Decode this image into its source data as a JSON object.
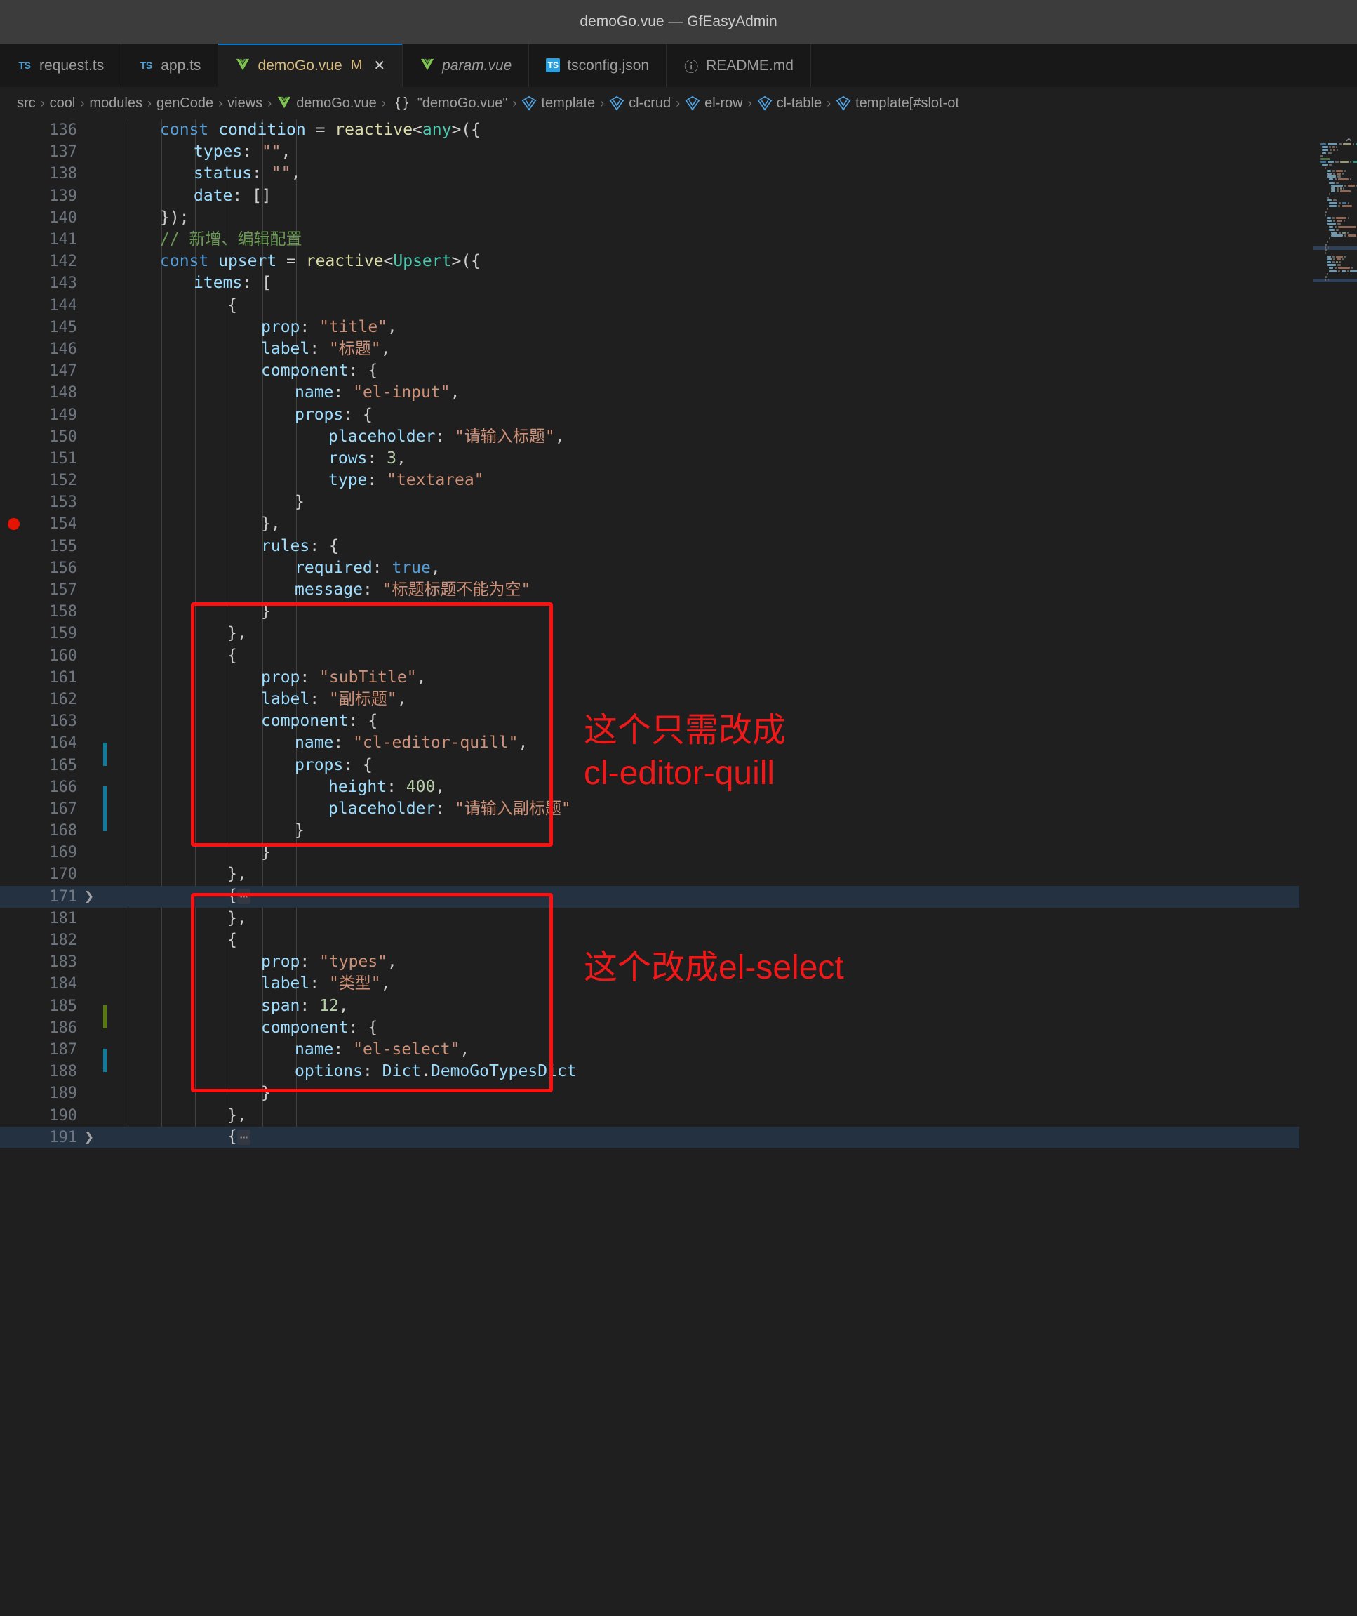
{
  "window": {
    "title": "demoGo.vue — GfEasyAdmin"
  },
  "tabs": [
    {
      "name": "request.ts",
      "icon": "typescript-icon",
      "active": false,
      "preview": false,
      "modified": false,
      "closable": false
    },
    {
      "name": "app.ts",
      "icon": "typescript-icon",
      "active": false,
      "preview": false,
      "modified": false,
      "closable": false
    },
    {
      "name": "demoGo.vue",
      "icon": "vue-icon",
      "active": true,
      "preview": false,
      "modified": true,
      "modified_mark": "M",
      "closable": true,
      "close_glyph": "✕"
    },
    {
      "name": "param.vue",
      "icon": "vue-icon",
      "active": false,
      "preview": true,
      "modified": false,
      "closable": false
    },
    {
      "name": "tsconfig.json",
      "icon": "tsconfig-icon",
      "active": false,
      "preview": false,
      "modified": false,
      "closable": false
    },
    {
      "name": "README.md",
      "icon": "info-icon",
      "active": false,
      "preview": false,
      "modified": false,
      "closable": false
    }
  ],
  "breadcrumb": {
    "separator": "›",
    "items": [
      {
        "label": "src",
        "icon": "none"
      },
      {
        "label": "cool",
        "icon": "none"
      },
      {
        "label": "modules",
        "icon": "none"
      },
      {
        "label": "genCode",
        "icon": "none"
      },
      {
        "label": "views",
        "icon": "none"
      },
      {
        "label": "demoGo.vue",
        "icon": "vue-icon"
      },
      {
        "label": "\"demoGo.vue\"",
        "icon": "braces-icon"
      },
      {
        "label": "template",
        "icon": "symbol-vue-icon"
      },
      {
        "label": "cl-crud",
        "icon": "symbol-vue-icon"
      },
      {
        "label": "el-row",
        "icon": "symbol-vue-icon"
      },
      {
        "label": "cl-table",
        "icon": "symbol-vue-icon"
      },
      {
        "label": "template[#slot-ot",
        "icon": "symbol-vue-icon"
      }
    ]
  },
  "editor": {
    "breakpoint_line": 154,
    "highlighted_lines": [
      171,
      191
    ],
    "diff_modified_lines": [
      164,
      166,
      167,
      187
    ],
    "diff_added_lines": [
      185
    ],
    "folded_lines": [
      171,
      191
    ],
    "fold_placeholder": "⋯",
    "lines": [
      {
        "n": 136,
        "tokens": [
          {
            "t": "kw",
            "v": "const "
          },
          {
            "t": "var",
            "v": "condition"
          },
          {
            "t": "pn",
            "v": " = "
          },
          {
            "t": "fn",
            "v": "reactive"
          },
          {
            "t": "pn",
            "v": "<"
          },
          {
            "t": "type",
            "v": "any"
          },
          {
            "t": "pn",
            "v": ">({"
          }
        ],
        "indent": 1
      },
      {
        "n": 137,
        "tokens": [
          {
            "t": "var",
            "v": "types"
          },
          {
            "t": "pn",
            "v": ": "
          },
          {
            "t": "str",
            "v": "\"\""
          },
          {
            "t": "pn",
            "v": ","
          }
        ],
        "indent": 2
      },
      {
        "n": 138,
        "tokens": [
          {
            "t": "var",
            "v": "status"
          },
          {
            "t": "pn",
            "v": ": "
          },
          {
            "t": "str",
            "v": "\"\""
          },
          {
            "t": "pn",
            "v": ","
          }
        ],
        "indent": 2
      },
      {
        "n": 139,
        "tokens": [
          {
            "t": "var",
            "v": "date"
          },
          {
            "t": "pn",
            "v": ": []"
          }
        ],
        "indent": 2
      },
      {
        "n": 140,
        "tokens": [
          {
            "t": "pn",
            "v": "});"
          }
        ],
        "indent": 1
      },
      {
        "n": 141,
        "tokens": [
          {
            "t": "cmt",
            "v": "// 新增、编辑配置"
          }
        ],
        "indent": 1
      },
      {
        "n": 142,
        "tokens": [
          {
            "t": "kw",
            "v": "const "
          },
          {
            "t": "var",
            "v": "upsert"
          },
          {
            "t": "pn",
            "v": " = "
          },
          {
            "t": "fn",
            "v": "reactive"
          },
          {
            "t": "pn",
            "v": "<"
          },
          {
            "t": "type",
            "v": "Upsert"
          },
          {
            "t": "pn",
            "v": ">({"
          }
        ],
        "indent": 1
      },
      {
        "n": 143,
        "tokens": [
          {
            "t": "var",
            "v": "items"
          },
          {
            "t": "pn",
            "v": ": ["
          }
        ],
        "indent": 2
      },
      {
        "n": 144,
        "tokens": [
          {
            "t": "pn",
            "v": "{"
          }
        ],
        "indent": 3
      },
      {
        "n": 145,
        "tokens": [
          {
            "t": "var",
            "v": "prop"
          },
          {
            "t": "pn",
            "v": ": "
          },
          {
            "t": "str",
            "v": "\"title\""
          },
          {
            "t": "pn",
            "v": ","
          }
        ],
        "indent": 4
      },
      {
        "n": 146,
        "tokens": [
          {
            "t": "var",
            "v": "label"
          },
          {
            "t": "pn",
            "v": ": "
          },
          {
            "t": "str",
            "v": "\"标题\""
          },
          {
            "t": "pn",
            "v": ","
          }
        ],
        "indent": 4
      },
      {
        "n": 147,
        "tokens": [
          {
            "t": "var",
            "v": "component"
          },
          {
            "t": "pn",
            "v": ": {"
          }
        ],
        "indent": 4
      },
      {
        "n": 148,
        "tokens": [
          {
            "t": "var",
            "v": "name"
          },
          {
            "t": "pn",
            "v": ": "
          },
          {
            "t": "str",
            "v": "\"el-input\""
          },
          {
            "t": "pn",
            "v": ","
          }
        ],
        "indent": 5
      },
      {
        "n": 149,
        "tokens": [
          {
            "t": "var",
            "v": "props"
          },
          {
            "t": "pn",
            "v": ": {"
          }
        ],
        "indent": 5
      },
      {
        "n": 150,
        "tokens": [
          {
            "t": "var",
            "v": "placeholder"
          },
          {
            "t": "pn",
            "v": ": "
          },
          {
            "t": "str",
            "v": "\"请输入标题\""
          },
          {
            "t": "pn",
            "v": ","
          }
        ],
        "indent": 6
      },
      {
        "n": 151,
        "tokens": [
          {
            "t": "var",
            "v": "rows"
          },
          {
            "t": "pn",
            "v": ": "
          },
          {
            "t": "num",
            "v": "3"
          },
          {
            "t": "pn",
            "v": ","
          }
        ],
        "indent": 6
      },
      {
        "n": 152,
        "tokens": [
          {
            "t": "var",
            "v": "type"
          },
          {
            "t": "pn",
            "v": ": "
          },
          {
            "t": "str",
            "v": "\"textarea\""
          }
        ],
        "indent": 6
      },
      {
        "n": 153,
        "tokens": [
          {
            "t": "pn",
            "v": "}"
          }
        ],
        "indent": 5
      },
      {
        "n": 154,
        "tokens": [
          {
            "t": "pn",
            "v": "},"
          }
        ],
        "indent": 4
      },
      {
        "n": 155,
        "tokens": [
          {
            "t": "var",
            "v": "rules"
          },
          {
            "t": "pn",
            "v": ": {"
          }
        ],
        "indent": 4
      },
      {
        "n": 156,
        "tokens": [
          {
            "t": "var",
            "v": "required"
          },
          {
            "t": "pn",
            "v": ": "
          },
          {
            "t": "kw",
            "v": "true"
          },
          {
            "t": "pn",
            "v": ","
          }
        ],
        "indent": 5
      },
      {
        "n": 157,
        "tokens": [
          {
            "t": "var",
            "v": "message"
          },
          {
            "t": "pn",
            "v": ": "
          },
          {
            "t": "str",
            "v": "\"标题标题不能为空\""
          }
        ],
        "indent": 5
      },
      {
        "n": 158,
        "tokens": [
          {
            "t": "pn",
            "v": "}"
          }
        ],
        "indent": 4
      },
      {
        "n": 159,
        "tokens": [
          {
            "t": "pn",
            "v": "},"
          }
        ],
        "indent": 3
      },
      {
        "n": 160,
        "tokens": [
          {
            "t": "pn",
            "v": "{"
          }
        ],
        "indent": 3
      },
      {
        "n": 161,
        "tokens": [
          {
            "t": "var",
            "v": "prop"
          },
          {
            "t": "pn",
            "v": ": "
          },
          {
            "t": "str",
            "v": "\"subTitle\""
          },
          {
            "t": "pn",
            "v": ","
          }
        ],
        "indent": 4
      },
      {
        "n": 162,
        "tokens": [
          {
            "t": "var",
            "v": "label"
          },
          {
            "t": "pn",
            "v": ": "
          },
          {
            "t": "str",
            "v": "\"副标题\""
          },
          {
            "t": "pn",
            "v": ","
          }
        ],
        "indent": 4
      },
      {
        "n": 163,
        "tokens": [
          {
            "t": "var",
            "v": "component"
          },
          {
            "t": "pn",
            "v": ": {"
          }
        ],
        "indent": 4
      },
      {
        "n": 164,
        "tokens": [
          {
            "t": "var",
            "v": "name"
          },
          {
            "t": "pn",
            "v": ": "
          },
          {
            "t": "str",
            "v": "\"cl-editor-quill\""
          },
          {
            "t": "pn",
            "v": ","
          }
        ],
        "indent": 5
      },
      {
        "n": 165,
        "tokens": [
          {
            "t": "var",
            "v": "props"
          },
          {
            "t": "pn",
            "v": ": {"
          }
        ],
        "indent": 5
      },
      {
        "n": 166,
        "tokens": [
          {
            "t": "var",
            "v": "height"
          },
          {
            "t": "pn",
            "v": ": "
          },
          {
            "t": "num",
            "v": "400"
          },
          {
            "t": "pn",
            "v": ","
          }
        ],
        "indent": 6
      },
      {
        "n": 167,
        "tokens": [
          {
            "t": "var",
            "v": "placeholder"
          },
          {
            "t": "pn",
            "v": ": "
          },
          {
            "t": "str",
            "v": "\"请输入副标题\""
          }
        ],
        "indent": 6
      },
      {
        "n": 168,
        "tokens": [
          {
            "t": "pn",
            "v": "}"
          }
        ],
        "indent": 5
      },
      {
        "n": 169,
        "tokens": [
          {
            "t": "pn",
            "v": "}"
          }
        ],
        "indent": 4
      },
      {
        "n": 170,
        "tokens": [
          {
            "t": "pn",
            "v": "},"
          }
        ],
        "indent": 3
      },
      {
        "n": 171,
        "tokens": [
          {
            "t": "pn",
            "v": "{"
          },
          {
            "t": "fold",
            "v": "⋯"
          }
        ],
        "indent": 3
      },
      {
        "n": 181,
        "tokens": [
          {
            "t": "pn",
            "v": "},"
          }
        ],
        "indent": 3
      },
      {
        "n": 182,
        "tokens": [
          {
            "t": "pn",
            "v": "{"
          }
        ],
        "indent": 3
      },
      {
        "n": 183,
        "tokens": [
          {
            "t": "var",
            "v": "prop"
          },
          {
            "t": "pn",
            "v": ": "
          },
          {
            "t": "str",
            "v": "\"types\""
          },
          {
            "t": "pn",
            "v": ","
          }
        ],
        "indent": 4
      },
      {
        "n": 184,
        "tokens": [
          {
            "t": "var",
            "v": "label"
          },
          {
            "t": "pn",
            "v": ": "
          },
          {
            "t": "str",
            "v": "\"类型\""
          },
          {
            "t": "pn",
            "v": ","
          }
        ],
        "indent": 4
      },
      {
        "n": 185,
        "tokens": [
          {
            "t": "var",
            "v": "span"
          },
          {
            "t": "pn",
            "v": ": "
          },
          {
            "t": "num",
            "v": "12"
          },
          {
            "t": "pn",
            "v": ","
          }
        ],
        "indent": 4
      },
      {
        "n": 186,
        "tokens": [
          {
            "t": "var",
            "v": "component"
          },
          {
            "t": "pn",
            "v": ": {"
          }
        ],
        "indent": 4
      },
      {
        "n": 187,
        "tokens": [
          {
            "t": "var",
            "v": "name"
          },
          {
            "t": "pn",
            "v": ": "
          },
          {
            "t": "str",
            "v": "\"el-select\""
          },
          {
            "t": "pn",
            "v": ","
          }
        ],
        "indent": 5
      },
      {
        "n": 188,
        "tokens": [
          {
            "t": "var",
            "v": "options"
          },
          {
            "t": "pn",
            "v": ": "
          },
          {
            "t": "var",
            "v": "Dict"
          },
          {
            "t": "pn",
            "v": "."
          },
          {
            "t": "var",
            "v": "DemoGoTypesDict"
          }
        ],
        "indent": 5
      },
      {
        "n": 189,
        "tokens": [
          {
            "t": "pn",
            "v": "}"
          }
        ],
        "indent": 4
      },
      {
        "n": 190,
        "tokens": [
          {
            "t": "pn",
            "v": "},"
          }
        ],
        "indent": 3
      },
      {
        "n": 191,
        "tokens": [
          {
            "t": "pn",
            "v": "{"
          },
          {
            "t": "fold",
            "v": "⋯"
          }
        ],
        "indent": 3
      }
    ]
  },
  "annotations": [
    {
      "id": "annot-quill",
      "text": "这个只需改成\ncl-editor-quill",
      "color": "#f01818",
      "target_lines": [
        160,
        170
      ]
    },
    {
      "id": "annot-select",
      "text": "这个改成el-select",
      "color": "#f01818",
      "target_lines": [
        182,
        190
      ]
    }
  ]
}
